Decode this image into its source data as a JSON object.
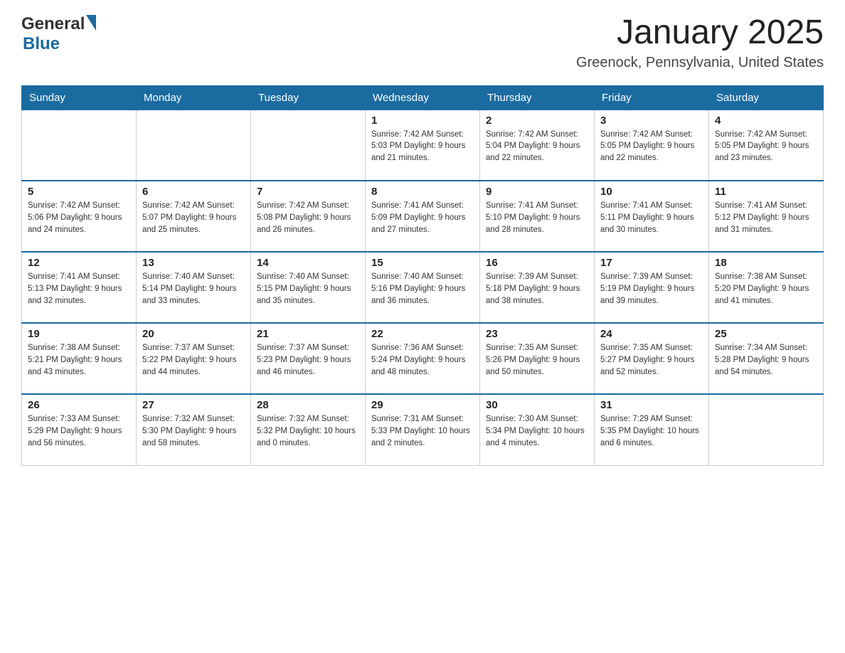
{
  "header": {
    "logo": {
      "text_general": "General",
      "text_blue": "Blue"
    },
    "title": "January 2025",
    "subtitle": "Greenock, Pennsylvania, United States"
  },
  "weekdays": [
    "Sunday",
    "Monday",
    "Tuesday",
    "Wednesday",
    "Thursday",
    "Friday",
    "Saturday"
  ],
  "weeks": [
    [
      {
        "day": "",
        "info": ""
      },
      {
        "day": "",
        "info": ""
      },
      {
        "day": "",
        "info": ""
      },
      {
        "day": "1",
        "info": "Sunrise: 7:42 AM\nSunset: 5:03 PM\nDaylight: 9 hours\nand 21 minutes."
      },
      {
        "day": "2",
        "info": "Sunrise: 7:42 AM\nSunset: 5:04 PM\nDaylight: 9 hours\nand 22 minutes."
      },
      {
        "day": "3",
        "info": "Sunrise: 7:42 AM\nSunset: 5:05 PM\nDaylight: 9 hours\nand 22 minutes."
      },
      {
        "day": "4",
        "info": "Sunrise: 7:42 AM\nSunset: 5:05 PM\nDaylight: 9 hours\nand 23 minutes."
      }
    ],
    [
      {
        "day": "5",
        "info": "Sunrise: 7:42 AM\nSunset: 5:06 PM\nDaylight: 9 hours\nand 24 minutes."
      },
      {
        "day": "6",
        "info": "Sunrise: 7:42 AM\nSunset: 5:07 PM\nDaylight: 9 hours\nand 25 minutes."
      },
      {
        "day": "7",
        "info": "Sunrise: 7:42 AM\nSunset: 5:08 PM\nDaylight: 9 hours\nand 26 minutes."
      },
      {
        "day": "8",
        "info": "Sunrise: 7:41 AM\nSunset: 5:09 PM\nDaylight: 9 hours\nand 27 minutes."
      },
      {
        "day": "9",
        "info": "Sunrise: 7:41 AM\nSunset: 5:10 PM\nDaylight: 9 hours\nand 28 minutes."
      },
      {
        "day": "10",
        "info": "Sunrise: 7:41 AM\nSunset: 5:11 PM\nDaylight: 9 hours\nand 30 minutes."
      },
      {
        "day": "11",
        "info": "Sunrise: 7:41 AM\nSunset: 5:12 PM\nDaylight: 9 hours\nand 31 minutes."
      }
    ],
    [
      {
        "day": "12",
        "info": "Sunrise: 7:41 AM\nSunset: 5:13 PM\nDaylight: 9 hours\nand 32 minutes."
      },
      {
        "day": "13",
        "info": "Sunrise: 7:40 AM\nSunset: 5:14 PM\nDaylight: 9 hours\nand 33 minutes."
      },
      {
        "day": "14",
        "info": "Sunrise: 7:40 AM\nSunset: 5:15 PM\nDaylight: 9 hours\nand 35 minutes."
      },
      {
        "day": "15",
        "info": "Sunrise: 7:40 AM\nSunset: 5:16 PM\nDaylight: 9 hours\nand 36 minutes."
      },
      {
        "day": "16",
        "info": "Sunrise: 7:39 AM\nSunset: 5:18 PM\nDaylight: 9 hours\nand 38 minutes."
      },
      {
        "day": "17",
        "info": "Sunrise: 7:39 AM\nSunset: 5:19 PM\nDaylight: 9 hours\nand 39 minutes."
      },
      {
        "day": "18",
        "info": "Sunrise: 7:38 AM\nSunset: 5:20 PM\nDaylight: 9 hours\nand 41 minutes."
      }
    ],
    [
      {
        "day": "19",
        "info": "Sunrise: 7:38 AM\nSunset: 5:21 PM\nDaylight: 9 hours\nand 43 minutes."
      },
      {
        "day": "20",
        "info": "Sunrise: 7:37 AM\nSunset: 5:22 PM\nDaylight: 9 hours\nand 44 minutes."
      },
      {
        "day": "21",
        "info": "Sunrise: 7:37 AM\nSunset: 5:23 PM\nDaylight: 9 hours\nand 46 minutes."
      },
      {
        "day": "22",
        "info": "Sunrise: 7:36 AM\nSunset: 5:24 PM\nDaylight: 9 hours\nand 48 minutes."
      },
      {
        "day": "23",
        "info": "Sunrise: 7:35 AM\nSunset: 5:26 PM\nDaylight: 9 hours\nand 50 minutes."
      },
      {
        "day": "24",
        "info": "Sunrise: 7:35 AM\nSunset: 5:27 PM\nDaylight: 9 hours\nand 52 minutes."
      },
      {
        "day": "25",
        "info": "Sunrise: 7:34 AM\nSunset: 5:28 PM\nDaylight: 9 hours\nand 54 minutes."
      }
    ],
    [
      {
        "day": "26",
        "info": "Sunrise: 7:33 AM\nSunset: 5:29 PM\nDaylight: 9 hours\nand 56 minutes."
      },
      {
        "day": "27",
        "info": "Sunrise: 7:32 AM\nSunset: 5:30 PM\nDaylight: 9 hours\nand 58 minutes."
      },
      {
        "day": "28",
        "info": "Sunrise: 7:32 AM\nSunset: 5:32 PM\nDaylight: 10 hours\nand 0 minutes."
      },
      {
        "day": "29",
        "info": "Sunrise: 7:31 AM\nSunset: 5:33 PM\nDaylight: 10 hours\nand 2 minutes."
      },
      {
        "day": "30",
        "info": "Sunrise: 7:30 AM\nSunset: 5:34 PM\nDaylight: 10 hours\nand 4 minutes."
      },
      {
        "day": "31",
        "info": "Sunrise: 7:29 AM\nSunset: 5:35 PM\nDaylight: 10 hours\nand 6 minutes."
      },
      {
        "day": "",
        "info": ""
      }
    ]
  ]
}
